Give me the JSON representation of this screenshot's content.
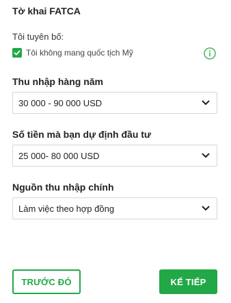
{
  "form": {
    "title": "Tờ khai FATCA",
    "declare_label": "Tôi tuyên bố:",
    "checkbox_label": "Tôi không mang quốc tịch Mỹ",
    "checkbox_checked": true
  },
  "fields": [
    {
      "label": "Thu nhập hàng năm",
      "value": "30 000 - 90 000 USD"
    },
    {
      "label": "Số tiền mà bạn dự định đầu tư",
      "value": "25 000- 80 000 USD"
    },
    {
      "label": "Nguồn thu nhập chính",
      "value": "Làm việc theo hợp đồng"
    }
  ],
  "buttons": {
    "back_label": "TRƯỚC ĐÓ",
    "next_label": "KẾ TIẾP"
  },
  "colors": {
    "accent": "#22a846"
  },
  "icons": {
    "info": "info-icon",
    "check": "check-icon",
    "dropdown": "chevron-down-icon"
  }
}
